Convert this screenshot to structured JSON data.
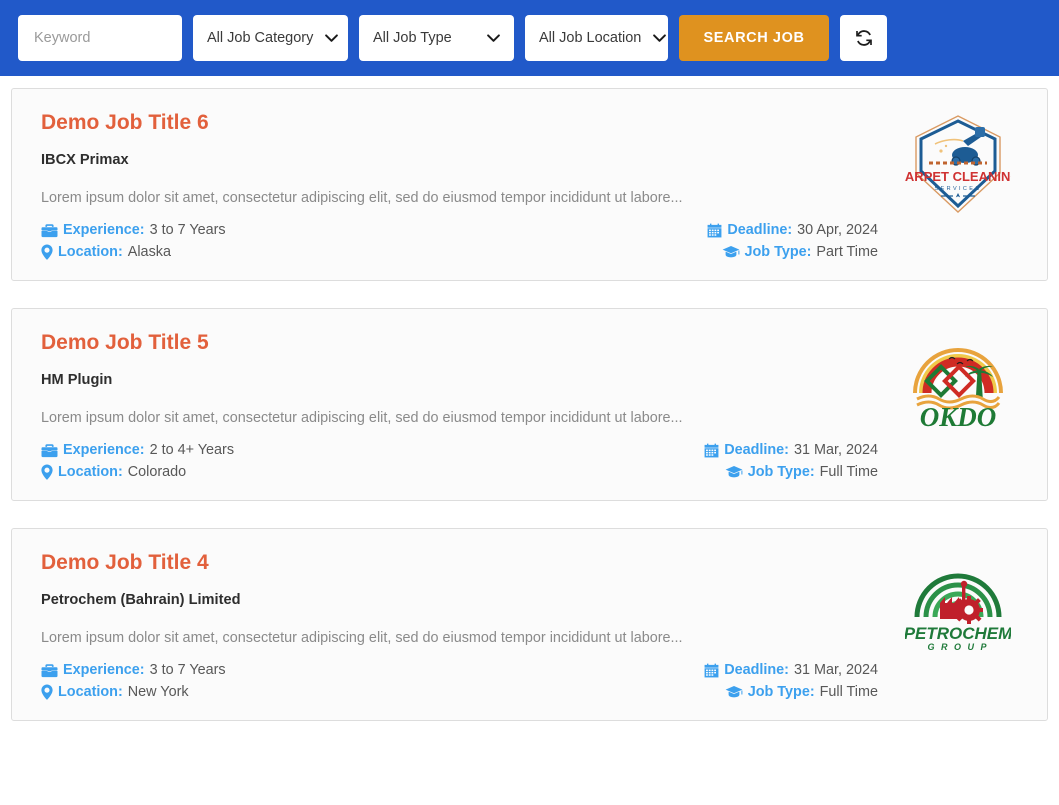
{
  "search": {
    "keyword_placeholder": "Keyword",
    "keyword_value": "",
    "category_selected": "All Job Category",
    "type_selected": "All Job Type",
    "location_selected": "All Job Location",
    "search_label": "SEARCH JOB",
    "reset_icon": "refresh-icon",
    "chevron_icon": "chevron-down-icon",
    "accent_blue": "#2159c9",
    "accent_orange": "#df921f"
  },
  "labels": {
    "experience": "Experience:",
    "location": "Location:",
    "deadline": "Deadline:",
    "job_type": "Job Type:",
    "experience_icon": "briefcase-icon",
    "location_icon": "map-pin-icon",
    "deadline_icon": "calendar-icon",
    "job_type_icon": "graduation-cap-icon"
  },
  "jobs": [
    {
      "title": "Demo Job Title 6",
      "company": "IBCX Primax",
      "description": "Lorem ipsum dolor sit amet, consectetur adipiscing elit, sed do eiusmod tempor incididunt ut labore...",
      "experience": "3 to 7 Years",
      "location": "Alaska",
      "deadline": "30 Apr, 2024",
      "job_type": "Part Time",
      "logo": "carpet-cleaning-services-logo",
      "logo_text_main": "CARPET CLEANING",
      "logo_text_sub": "SERVICES"
    },
    {
      "title": "Demo Job Title 5",
      "company": "HM Plugin",
      "description": "Lorem ipsum dolor sit amet, consectetur adipiscing elit, sed do eiusmod tempor incididunt ut labore...",
      "experience": "2 to 4+ Years",
      "location": "Colorado",
      "deadline": "31 Mar, 2024",
      "job_type": "Full Time",
      "logo": "okdo-logo",
      "logo_text_main": "OKDO",
      "logo_text_sub": ""
    },
    {
      "title": "Demo Job Title 4",
      "company": "Petrochem (Bahrain) Limited",
      "description": "Lorem ipsum dolor sit amet, consectetur adipiscing elit, sed do eiusmod tempor incididunt ut labore...",
      "experience": "3 to 7 Years",
      "location": "New York",
      "deadline": "31 Mar, 2024",
      "job_type": "Full Time",
      "logo": "petrochem-group-logo",
      "logo_text_main": "PETROCHEM",
      "logo_text_sub": "G R O U P"
    }
  ]
}
